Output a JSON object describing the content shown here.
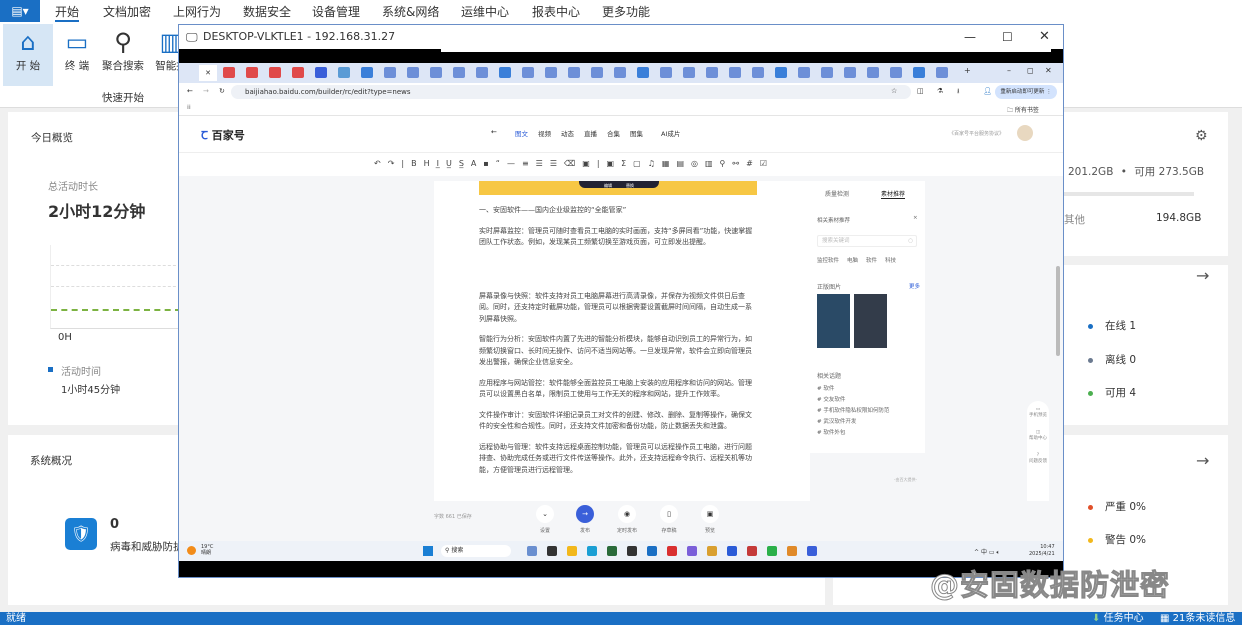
{
  "menu": {
    "app_icon": "app-menu-icon",
    "items": [
      "开始",
      "文档加密",
      "上网行为",
      "数据安全",
      "设备管理",
      "系统&网络",
      "运维中心",
      "报表中心",
      "更多功能"
    ]
  },
  "ribbon": {
    "buttons": [
      "开 始",
      "终 端",
      "聚合搜索",
      "智能报"
    ],
    "group_label": "快速开始"
  },
  "today": {
    "title": "今日概览",
    "total_label": "总活动时长",
    "total_value": "2小时12分钟",
    "axis_label": "0H",
    "legend_label": "活动时间",
    "legend_value": "1小时45分钟"
  },
  "system": {
    "title": "系统概况",
    "count": "0",
    "label": "病毒和威胁防护"
  },
  "disk": {
    "used": "201.2GB",
    "free_label": "可用",
    "free": "273.5GB",
    "other_label": "其他",
    "other": "194.8GB"
  },
  "terminals": {
    "items": [
      {
        "label": "在线",
        "value": "1",
        "color": "#1a6fc4"
      },
      {
        "label": "离线",
        "value": "0",
        "color": "#6b7a90"
      },
      {
        "label": "可用",
        "value": "4",
        "color": "#4caf50"
      }
    ]
  },
  "alerts": {
    "items": [
      {
        "label": "严重",
        "value": "0%",
        "color": "#e0502a"
      },
      {
        "label": "警告",
        "value": "0%",
        "color": "#f2b81c"
      }
    ]
  },
  "status": {
    "left": "就绪",
    "task_center": "任务中心",
    "unread": "21条未读信息"
  },
  "remote": {
    "title": "DESKTOP-VLKTLE1 - 192.168.31.27",
    "url": "baijiahao.baidu.com/builder/rc/edit?type=news",
    "update_btn": "重新启动即可更新",
    "bookmarks": "所有书签",
    "brand": "百家号",
    "nav": [
      "图文",
      "视频",
      "动态",
      "直播",
      "合集",
      "图集",
      "AI成片"
    ],
    "agreement": "《百家号平台服务协议》",
    "article": {
      "images_caption": [
        "编辑",
        "替换"
      ],
      "heading": "一、安固软件——国内企业级监控的“全能管家”",
      "paragraphs": [
        "实时屏幕监控：管理员可随时查看员工电脑的实时画面，支持“多屏同看”功能，快速掌握团队工作状态。例如，发现某员工频繁切换至游戏页面，可立即发出提醒。",
        "屏幕录像与快照：软件支持对员工电脑屏幕进行高清录像，并保存为视频文件供日后查阅。同时，还支持定时截屏功能，管理员可以根据需要设置截屏时间间隔，自动生成一系列屏幕快照。",
        "智能行为分析：安固软件内置了先进的智能分析模块，能够自动识别员工的异常行为，如频繁切换窗口、长时间无操作、访问不适当网站等。一旦发现异常，软件会立即向管理员发出警报，确保企业信息安全。",
        "应用程序与网站管控：软件能够全面监控员工电脑上安装的应用程序和访问的网站。管理员可以设置黑白名单，限制员工使用与工作无关的程序和网站，提升工作效率。",
        "文件操作审计：安固软件详细记录员工对文件的创建、修改、删除、复制等操作，确保文件的安全性和合规性。同时，还支持文件加密和备份功能，防止数据丢失和泄露。",
        "远程协助与管理：软件支持远程桌面控制功能，管理员可以远程操作员工电脑，进行问题排查、协助完成任务或进行文件传送等操作。此外，还支持远程命令执行、远程关机等功能，方便管理员进行远程管理。"
      ]
    },
    "side": {
      "tabs": [
        "质量检测",
        "素材推荐"
      ],
      "rec_title": "相关素材推荐",
      "search_placeholder": "搜索关键词",
      "tags": [
        "监控软件",
        "电脑",
        "软件",
        "科技"
      ],
      "images_title": "正版图片",
      "more": "更多",
      "topics_title": "相关话题",
      "topics": [
        "# 软件",
        "# 交友软件",
        "# 手机软件隐私权限如何防范",
        "# 武汉软件开发",
        "# 软件外包"
      ],
      "footer": "-由百大提供-"
    },
    "float": [
      "手机预览",
      "帮助中心",
      "问题反馈"
    ],
    "wordcount": "字数 661  已保存",
    "actions": [
      "设置",
      "发布",
      "定时发布",
      "存草稿",
      "预览"
    ],
    "taskbar": {
      "weather_temp": "19°C",
      "weather_desc": "晴朗",
      "search": "搜索",
      "ime": "中",
      "time": "10:47",
      "date": "2025/4/21"
    }
  },
  "watermark": "@安固数据防泄密"
}
